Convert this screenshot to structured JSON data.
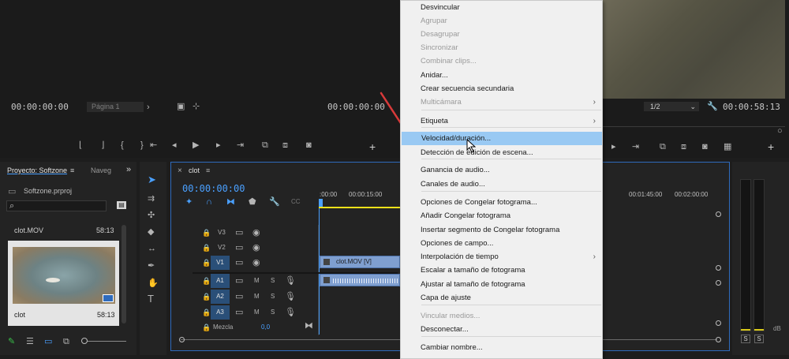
{
  "source_monitor": {
    "timecode_left": "00:00:00:00",
    "page_label": "Página 1",
    "timecode_right": "00:00:00:00"
  },
  "program_monitor": {
    "zoom_select": "1/2",
    "timecode": "00:00:58:13"
  },
  "project": {
    "tab_title": "Proyecto: Softzone",
    "tab_menu": "≡",
    "tab_nav": "Naveg",
    "tab_more": "»",
    "file_name": "Softzone.prproj",
    "clip1_name": "clot.MOV",
    "clip1_dur": "58:13",
    "clip2_name": "clot",
    "clip2_dur": "58:13"
  },
  "timeline": {
    "close": "×",
    "seq_name": "clot",
    "seq_menu": "≡",
    "timecode": "00:00:00:00",
    "ruler_left": [
      ":00:00",
      "00:00:15:00"
    ],
    "ruler_right": [
      "00:01:45:00",
      "00:02:00:00"
    ],
    "v_tracks": [
      "V3",
      "V2",
      "V1"
    ],
    "a_tracks": [
      "A1",
      "A2",
      "A3"
    ],
    "mix_label": "Mezcla",
    "mix_value": "0,0",
    "clip_v_label": "clot.MOV [V]",
    "m": "M",
    "s": "S"
  },
  "meter": {
    "db_label": "dB",
    "s1": "S",
    "s2": "S"
  },
  "menu_items": [
    {
      "label": "Desvincular",
      "disabled": false
    },
    {
      "label": "Agrupar",
      "disabled": true
    },
    {
      "label": "Desagrupar",
      "disabled": true
    },
    {
      "label": "Sincronizar",
      "disabled": true
    },
    {
      "label": "Combinar clips...",
      "disabled": true
    },
    {
      "label": "Anidar...",
      "disabled": false
    },
    {
      "label": "Crear secuencia secundaria",
      "disabled": false
    },
    {
      "label": "Multicámara",
      "disabled": true,
      "submenu": true
    },
    {
      "label": "Etiqueta",
      "disabled": false,
      "submenu": true
    },
    {
      "label": "Velocidad/duración...",
      "disabled": false,
      "highlighted": true
    },
    {
      "label": "Detección de edición de escena...",
      "disabled": false
    },
    {
      "label": "Ganancia de audio...",
      "disabled": false
    },
    {
      "label": "Canales de audio...",
      "disabled": false
    },
    {
      "label": "Opciones de Congelar fotograma...",
      "disabled": false
    },
    {
      "label": "Añadir Congelar fotograma",
      "disabled": false
    },
    {
      "label": "Insertar segmento de Congelar fotograma",
      "disabled": false
    },
    {
      "label": "Opciones de campo...",
      "disabled": false
    },
    {
      "label": "Interpolación de tiempo",
      "disabled": false,
      "submenu": true
    },
    {
      "label": "Escalar a tamaño de fotograma",
      "disabled": false
    },
    {
      "label": "Ajustar al tamaño de fotograma",
      "disabled": false
    },
    {
      "label": "Capa de ajuste",
      "disabled": false
    },
    {
      "label": "Vincular medios...",
      "disabled": true
    },
    {
      "label": "Desconectar...",
      "disabled": false
    },
    {
      "label": "Cambiar nombre...",
      "disabled": false
    }
  ],
  "submenu_arrow": "›",
  "colors": {
    "accent_blue": "#4aa0ff",
    "menu_highlight": "#99c9f3",
    "arrow_red": "#d83a3a",
    "clip_video": "#7f9fd0",
    "timeline_needle": "#f0e21a"
  }
}
